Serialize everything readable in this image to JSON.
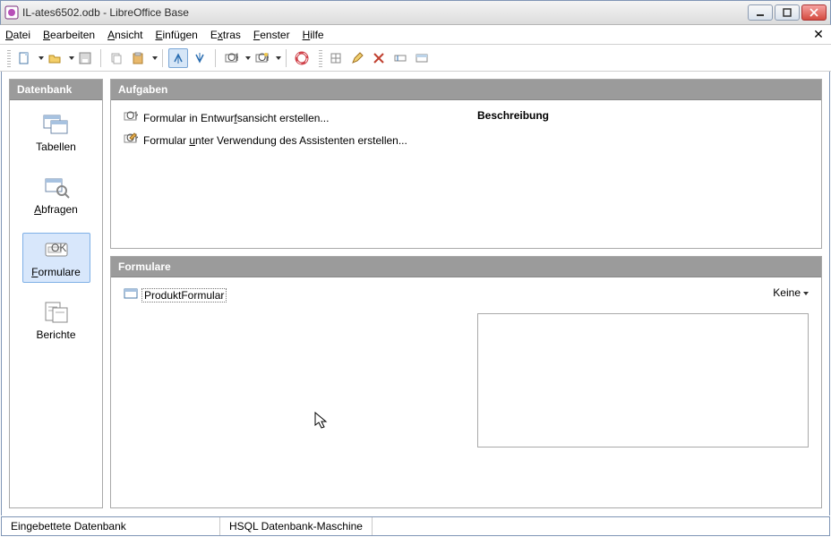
{
  "window": {
    "title": "IL-ates6502.odb - LibreOffice Base"
  },
  "menu": {
    "file": {
      "label": "Datei",
      "u": 0
    },
    "edit": {
      "label": "Bearbeiten",
      "u": 0
    },
    "view": {
      "label": "Ansicht",
      "u": 0
    },
    "insert": {
      "label": "Einfügen",
      "u": 0
    },
    "tools": {
      "label": "Extras",
      "u": 1
    },
    "window": {
      "label": "Fenster",
      "u": 0
    },
    "help": {
      "label": "Hilfe",
      "u": 0
    }
  },
  "sidebar": {
    "header": "Datenbank",
    "items": [
      {
        "label": "Tabellen",
        "u": -1,
        "icon": "tables"
      },
      {
        "label": "Abfragen",
        "u": 0,
        "icon": "queries"
      },
      {
        "label": "Formulare",
        "u": 0,
        "icon": "forms",
        "selected": true
      },
      {
        "label": "Berichte",
        "u": -1,
        "icon": "reports"
      }
    ]
  },
  "tasks": {
    "header": "Aufgaben",
    "items": [
      {
        "label": "Formular in Entwurfsansicht erstellen...",
        "u": 18
      },
      {
        "label": "Formular unter Verwendung des Assistenten erstellen...",
        "u": 9
      }
    ],
    "description_label": "Beschreibung"
  },
  "forms": {
    "header": "Formulare",
    "objects": [
      {
        "name": "ProduktFormular"
      }
    ],
    "view_label": "Keine"
  },
  "status": {
    "left": "Eingebettete Datenbank",
    "engine": "HSQL Datenbank-Maschine"
  }
}
